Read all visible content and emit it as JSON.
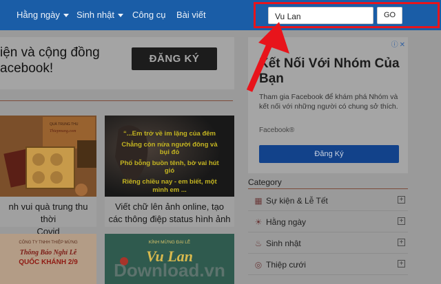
{
  "nav": {
    "items": [
      {
        "label": "Hằng ngày",
        "dropdown": true
      },
      {
        "label": "Sinh nhật",
        "dropdown": true
      },
      {
        "label": "Công cụ",
        "dropdown": false
      },
      {
        "label": "Bài viết",
        "dropdown": false
      }
    ]
  },
  "search": {
    "value": "Vu Lan",
    "button_label": "GO"
  },
  "banner": {
    "line1": "iện và cộng đồng",
    "line2": "acebook!",
    "button_label": "ĐĂNG KÝ"
  },
  "cards": [
    {
      "title_line1": "nh vui quà trung thu thời",
      "title_line2": "Covid"
    },
    {
      "title_line1": "Viết chữ lên ảnh online, tạo",
      "title_line2": "các thông điệp status hình ảnh"
    },
    {
      "img_text": "...Em trở về im lặng của đêm\nChẳng còn nửa người đông và bụi đỏ\nPhố bỗng buồn tênh, bờ vai hút gió\nRiêng chiều nay - em biết, một mình em ..."
    },
    {
      "img_text1": "CÔNG TY TNHH THIỆP MỪNG",
      "img_text2": "Thông Báo Nghỉ Lễ",
      "img_text3": "QUỐC KHÁNH 2/9"
    },
    {
      "img_text1": "KÍNH MỪNG ĐẠI LỄ",
      "img_text2": "Vu Lan"
    },
    {
      "img_text1": "QUÀ TRUNG THU",
      "img_text2": "Thiepmung.com"
    }
  ],
  "watermark": "Download.vn",
  "sidebar": {
    "ad": {
      "corner": "ⓘ✕",
      "title": "Kết Nối Với Nhóm Của Bạn",
      "desc": "Tham gia Facebook để khám phá Nhóm và kết nối với những người có chung sở thích.",
      "brand": "Facebook®",
      "button_label": "Đăng Ký"
    },
    "category_title": "Category",
    "categories": [
      {
        "label": "Sự kiện & Lễ Tết",
        "icon": "calendar-icon"
      },
      {
        "label": "Hằng ngày",
        "icon": "sun-icon"
      },
      {
        "label": "Sinh nhật",
        "icon": "cake-icon"
      },
      {
        "label": "Thiệp cưới",
        "icon": "rings-icon"
      }
    ]
  },
  "colors": {
    "nav": "#1a5da7",
    "highlight": "#e8141b"
  }
}
